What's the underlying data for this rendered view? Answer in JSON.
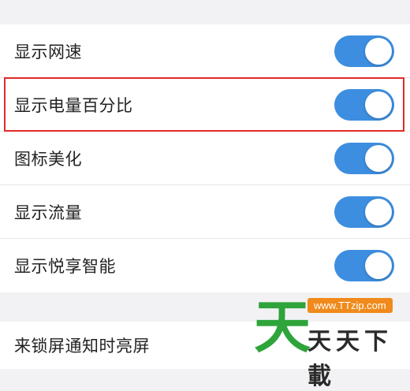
{
  "settings": {
    "items": [
      {
        "label": "显示网速",
        "enabled": true
      },
      {
        "label": "显示电量百分比",
        "enabled": true,
        "highlighted": true
      },
      {
        "label": "图标美化",
        "enabled": true
      },
      {
        "label": "显示流量",
        "enabled": true
      },
      {
        "label": "显示悦享智能",
        "enabled": true
      }
    ],
    "lockscreen_label": "来锁屏通知时亮屏"
  },
  "watermark": {
    "logo_char": "天",
    "url": "www.TTzip.com",
    "text": "天天下載"
  },
  "colors": {
    "toggle_on": "#3d8ee0",
    "highlight_border": "#e02a2a",
    "watermark_green": "#2ea43a",
    "watermark_orange": "#f08a1c"
  }
}
